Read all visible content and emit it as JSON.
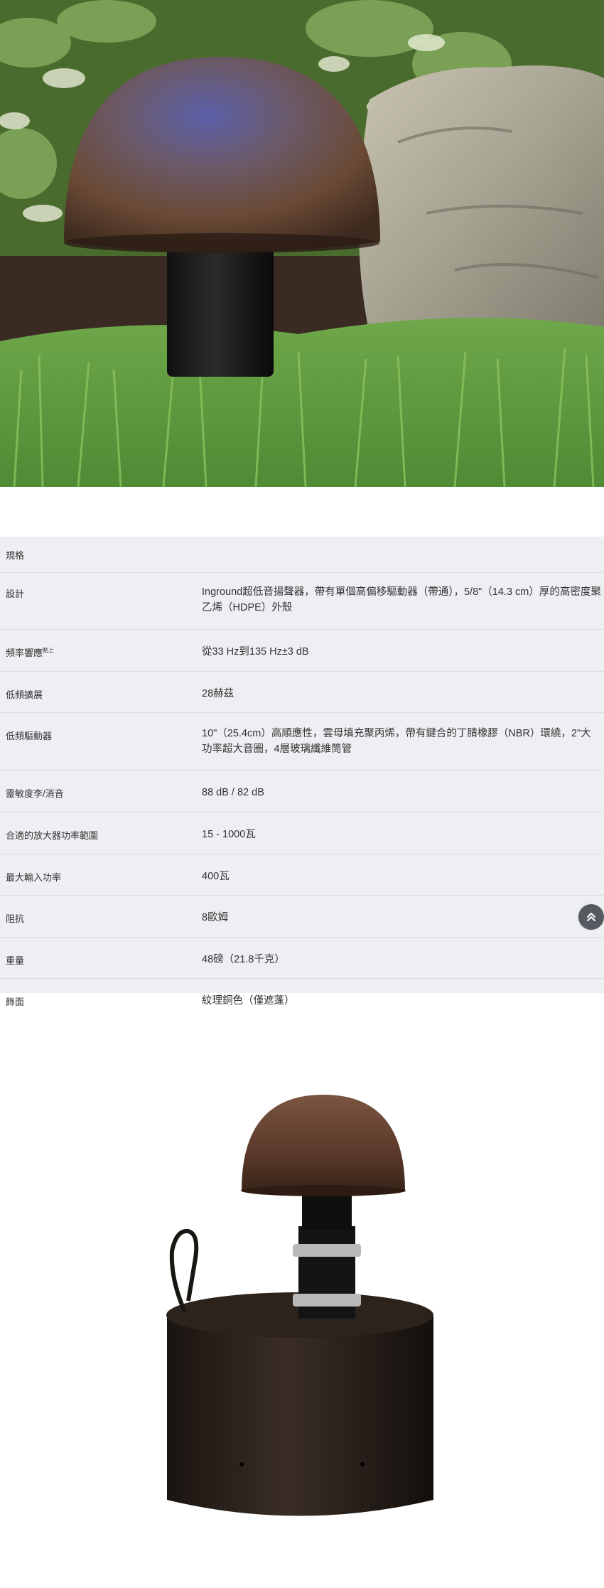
{
  "hero": {
    "alt": ""
  },
  "specs": {
    "title": "規格",
    "rows": [
      {
        "label": "設計",
        "value": "Inground超低音揚聲器，帶有單個高偏移驅動器（帶通），5/8\"（14.3 cm）厚的高密度聚乙烯（HDPE）外殼"
      },
      {
        "label": "頻率響應",
        "note": "點上",
        "value": "從33 Hz到135 Hz±3 dB"
      },
      {
        "label": "低頻擴展",
        "value": "28赫茲"
      },
      {
        "label": "低頻驅動器",
        "value": "10\"（25.4cm）高順應性，雲母填充聚丙烯，帶有鍵合的丁腈橡膠（NBR）環繞，2\"大功率超大音圈，4層玻璃纖維筒管"
      },
      {
        "label": "靈敏度李/消音",
        "value": "88 dB / 82 dB"
      },
      {
        "label": "合適的放大器功率範圍",
        "value": "15 - 1000瓦"
      },
      {
        "label": "最大輸入功率",
        "value": "400瓦"
      },
      {
        "label": "阻抗",
        "value": "8歐姆"
      },
      {
        "label": "重量",
        "value": "48磅（21.8千克）"
      },
      {
        "label": "飾面",
        "value": "紋理銅色（僅遮蓬）"
      }
    ]
  },
  "scroll_top": {
    "icon": "double-chevron-up-icon"
  },
  "colors": {
    "table_bg": "#edeff2",
    "divider": "#d9dce1",
    "bronze": "#6b4a35"
  }
}
